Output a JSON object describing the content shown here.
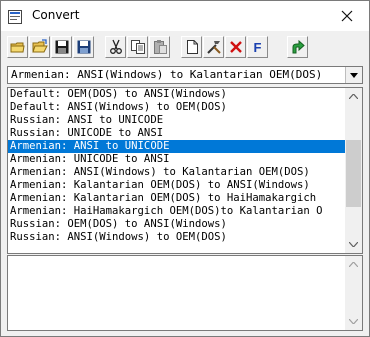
{
  "window": {
    "title": "Convert"
  },
  "icons": {
    "app": "convert-app-icon",
    "close": "close-icon"
  },
  "toolbar": {
    "buttons": [
      {
        "name": "new-file-icon"
      },
      {
        "name": "open-folder-icon"
      },
      {
        "name": "save-icon"
      },
      {
        "name": "save-as-icon"
      },
      {
        "name": "cut-icon"
      },
      {
        "name": "copy-icon"
      },
      {
        "name": "paste-icon"
      },
      {
        "name": "new-document-icon"
      },
      {
        "name": "edit-tools-icon"
      },
      {
        "name": "delete-icon"
      },
      {
        "name": "font-icon",
        "label": "F"
      },
      {
        "name": "run-arrow-icon"
      }
    ]
  },
  "combo": {
    "selected": "Armenian: ANSI(Windows) to Kalantarian OEM(DOS)"
  },
  "list": {
    "items": [
      "Default: OEM(DOS) to ANSI(Windows)",
      "Default: ANSI(Windows) to OEM(DOS)",
      "Russian: ANSI to UNICODE",
      "Russian: UNICODE to ANSI",
      "Armenian: ANSI to UNICODE",
      "Armenian: UNICODE to ANSI",
      "Armenian: ANSI(Windows) to Kalantarian OEM(DOS)",
      "Armenian: Kalantarian OEM(DOS) to ANSI(Windows)",
      "Armenian: Kalantarian OEM(DOS) to HaiHamakargich",
      "Armenian: HaiHamakargich OEM(DOS)to Kalantarian O",
      "Russian: OEM(DOS) to ANSI(Windows)",
      "Russian: ANSI(Windows) to OEM(DOS)"
    ],
    "selected_index": 4
  },
  "colors": {
    "selection": "#0078d7",
    "window_bg": "#f0f0f0"
  }
}
